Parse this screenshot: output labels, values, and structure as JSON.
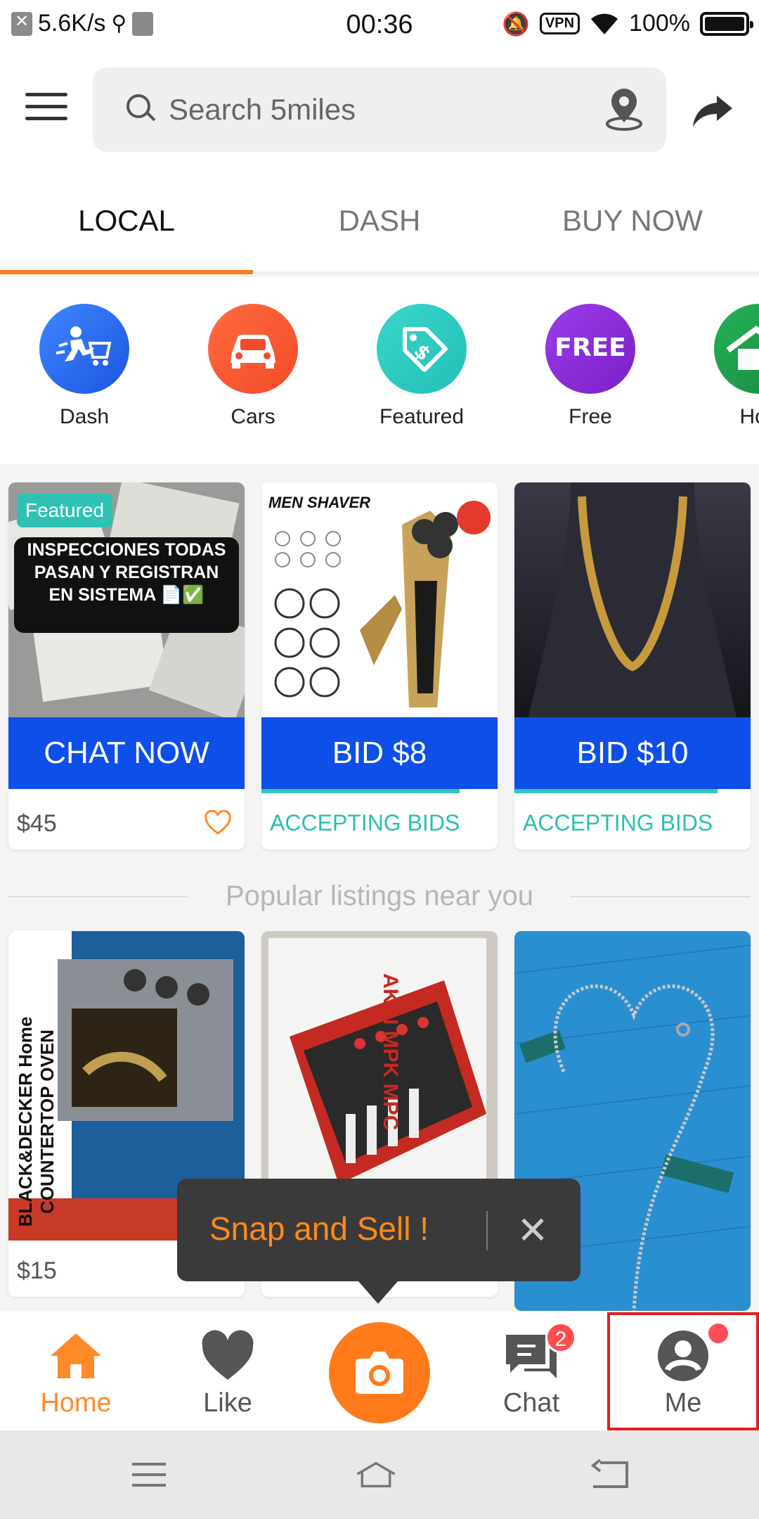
{
  "status_bar": {
    "speed": "5.6K/s",
    "time": "00:36",
    "vpn": "VPN",
    "battery": "100%"
  },
  "header": {
    "search_placeholder": "Search 5miles"
  },
  "tabs": [
    {
      "label": "LOCAL",
      "active": true
    },
    {
      "label": "DASH",
      "active": false
    },
    {
      "label": "BUY NOW",
      "active": false
    }
  ],
  "categories": [
    {
      "label": "Dash",
      "color": "#2a6bf0",
      "icon": "delivery-runner-icon"
    },
    {
      "label": "Cars",
      "color": "#ff5a36",
      "icon": "car-icon"
    },
    {
      "label": "Featured",
      "color": "#2cc9c0",
      "icon": "price-tag-icon"
    },
    {
      "label": "Free",
      "color": "#8a2be2",
      "icon": "free-icon",
      "badge_text": "FREE"
    },
    {
      "label": "Hou",
      "color": "#1e9e4a",
      "icon": "house-icon"
    }
  ],
  "featured_cards": [
    {
      "badge": "Featured",
      "overlay_text": "INSPECCIONES TODAS PASAN Y REGISTRAN EN SISTEMA 📄✅",
      "action": "CHAT NOW",
      "footer": "$45"
    },
    {
      "image_text": "MEN SHAVER",
      "action": "BID $8",
      "footer": "ACCEPTING BIDS",
      "progress": 0.84
    },
    {
      "action": "BID $10",
      "footer": "ACCEPTING BIDS",
      "progress": 0.86
    }
  ],
  "divider": {
    "text": "Popular listings near you"
  },
  "listings": [
    {
      "price": "$15",
      "image_text": "BLACK&DECKER Home COUNTERTOP OVEN"
    },
    {
      "price": "",
      "image_text": "AKAI MPK MPC"
    },
    {
      "price": ""
    }
  ],
  "tooltip": {
    "text": "Snap and Sell !",
    "close": "✕"
  },
  "bottom_nav": {
    "home": "Home",
    "like": "Like",
    "chat": "Chat",
    "chat_badge": "2",
    "me": "Me"
  },
  "colors": {
    "accent": "#ff7a1a",
    "action_blue": "#0d4fe8",
    "teal": "#2bbfb0"
  }
}
